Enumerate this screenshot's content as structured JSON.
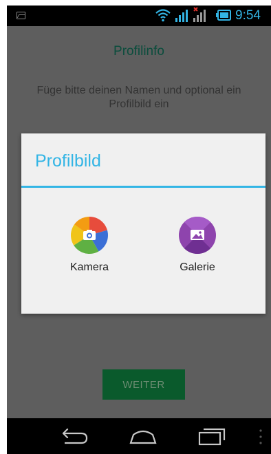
{
  "status_bar": {
    "time": "9:54",
    "icons": [
      "image-notification-icon",
      "wifi-icon",
      "signal-icon",
      "signal-no-sim-icon",
      "battery-icon"
    ],
    "accent_color": "#33b5e5"
  },
  "screen": {
    "title": "Profilinfo",
    "description": "Füge bitte deinen Namen und optional ein Profilbild ein",
    "continue_button": "WEITER"
  },
  "dialog": {
    "title": "Profilbild",
    "accent_color": "#33b5e5",
    "options": [
      {
        "label": "Kamera",
        "icon": "camera-icon"
      },
      {
        "label": "Galerie",
        "icon": "gallery-icon"
      }
    ]
  },
  "nav_bar": {
    "icons": [
      "back-icon",
      "home-icon",
      "recents-icon",
      "menu-icon"
    ]
  }
}
